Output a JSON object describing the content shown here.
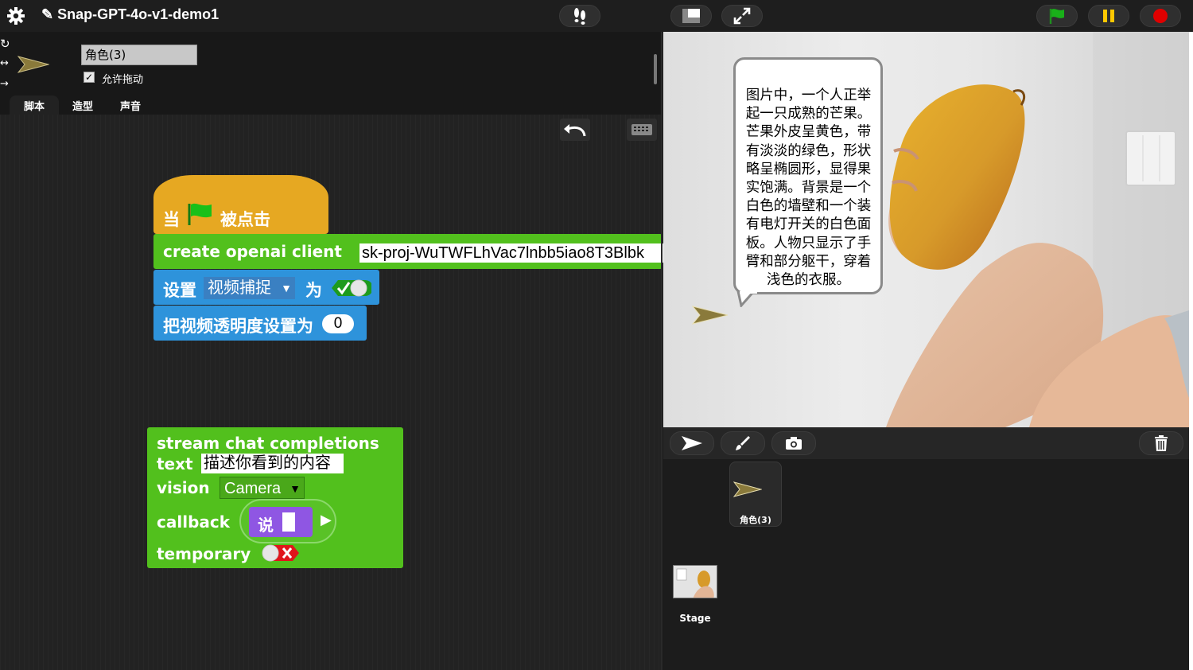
{
  "window": {
    "title": "Snap-GPT-4o-v1-demo1"
  },
  "sprite": {
    "name": "角色(3)",
    "draggable_label": "允许拖动",
    "draggable_checked": true
  },
  "tabs": [
    {
      "label": "脚本"
    },
    {
      "label": "造型"
    },
    {
      "label": "声音"
    }
  ],
  "blocks": {
    "hat": {
      "when": "当",
      "clicked": "被点击"
    },
    "create_client": {
      "label": "create openai client",
      "key": "sk-proj-WuTWFLhVac7lnbb5iao8T3Blbk"
    },
    "set_video": {
      "set": "设置",
      "option": "视频捕捉",
      "to": "为"
    },
    "transparency": {
      "label": "把视频透明度设置为",
      "value": "0"
    },
    "stream": {
      "line1": "stream chat completions",
      "text_label": "text",
      "text_value": "描述你看到的内容",
      "vision_label": "vision",
      "vision_value": "Camera",
      "callback_label": "callback",
      "say": "说",
      "temporary_label": "temporary"
    }
  },
  "stage": {
    "speech": "图片中，一个人正举起一只成熟的芒果。芒果外皮呈黄色，带有淡淡的绿色，形状略呈椭圆形，显得果实饱满。背景是一个白色的墙壁和一个装有电灯开关的白色面板。人物只显示了手臂和部分躯干，穿着浅色的衣服。"
  },
  "corral": {
    "sprite_name": "角色(3)",
    "stage_label": "Stage"
  },
  "colors": {
    "motion_blue": "#2e93db",
    "operators_green": "#52c01d",
    "control_orange": "#e6a822",
    "looks_purple": "#8f56e3"
  }
}
